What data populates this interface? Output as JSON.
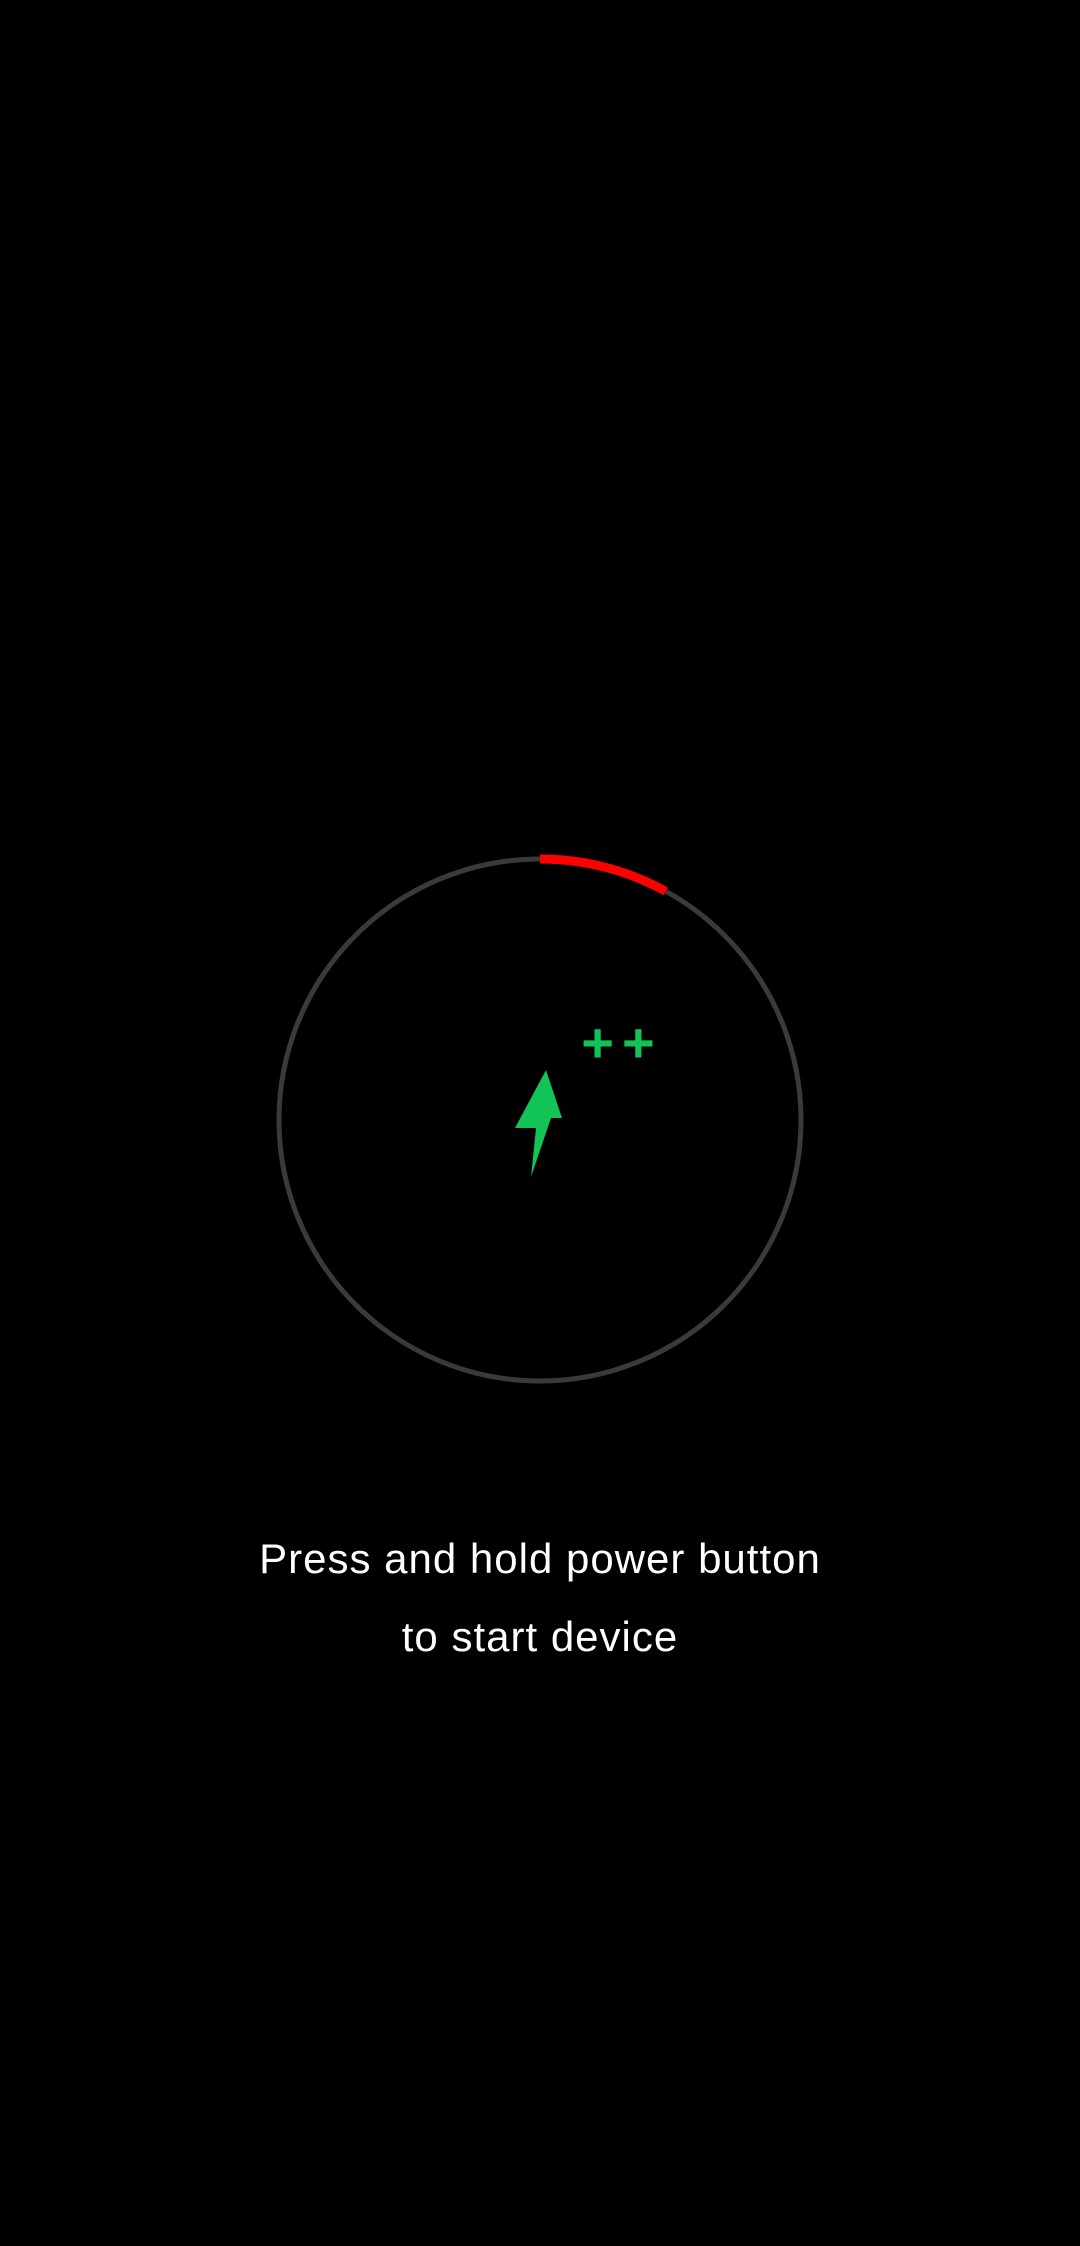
{
  "screen": {
    "background_color": "#000000"
  },
  "charging": {
    "battery_level": 0.08,
    "ring_track_color": "#3a3a3a",
    "ring_progress_color": "#ff0000",
    "bolt_icon": "lightning-bolt-icon",
    "bolt_color": "#11c455",
    "fast_charge_indicator": "++",
    "indicator_color": "#11c455"
  },
  "message": {
    "line1": "Press and hold power button",
    "line2": "to start device",
    "text_color": "#ffffff"
  }
}
